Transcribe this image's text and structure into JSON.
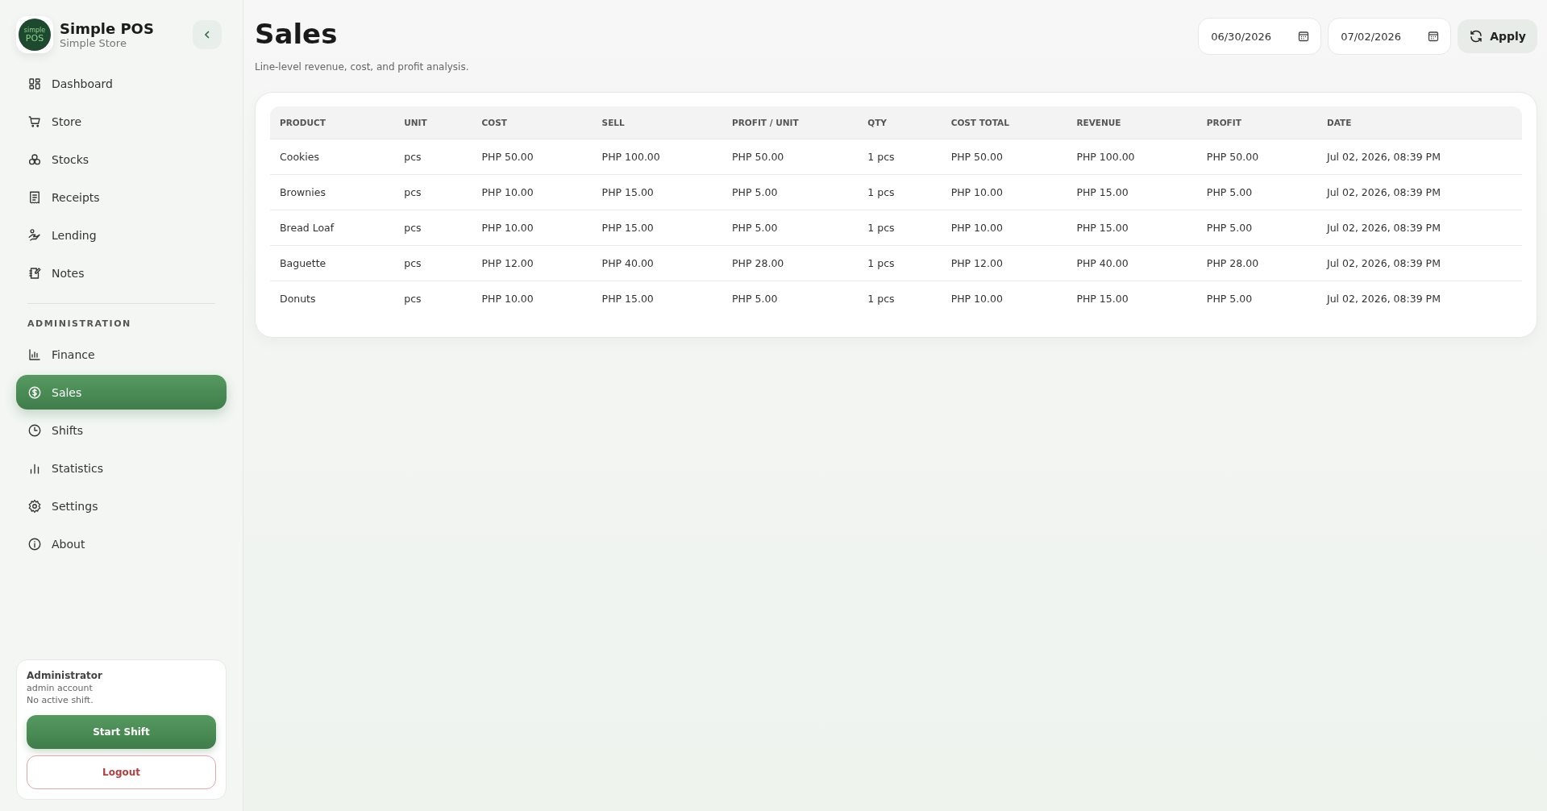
{
  "brand": {
    "title": "Simple POS",
    "subtitle": "Simple Store",
    "logo_top": "simple",
    "logo_bottom": "POS"
  },
  "nav": [
    {
      "label": "Dashboard",
      "kind": "dashboard",
      "selected": false
    },
    {
      "label": "Store",
      "kind": "cart",
      "selected": false
    },
    {
      "label": "Stocks",
      "kind": "boxes",
      "selected": false
    },
    {
      "label": "Receipts",
      "kind": "receipt",
      "selected": false
    },
    {
      "label": "Lending",
      "kind": "hand",
      "selected": false
    },
    {
      "label": "Notes",
      "kind": "notes",
      "selected": false
    }
  ],
  "admin_section": {
    "heading": "ADMINISTRATION",
    "items": [
      {
        "label": "Finance",
        "kind": "chart",
        "selected": false
      },
      {
        "label": "Sales",
        "kind": "dollar",
        "selected": true
      },
      {
        "label": "Shifts",
        "kind": "clock",
        "selected": false
      },
      {
        "label": "Statistics",
        "kind": "bars",
        "selected": false
      },
      {
        "label": "Settings",
        "kind": "gear",
        "selected": false
      },
      {
        "label": "About",
        "kind": "info",
        "selected": false
      }
    ]
  },
  "user_card": {
    "name": "Administrator",
    "role": "admin account",
    "shift_status": "No active shift.",
    "start_button": "Start Shift",
    "logout_button": "Logout"
  },
  "page": {
    "title": "Sales",
    "subtitle": "Line-level revenue, cost, and profit analysis.",
    "date_from": "06/30/2026",
    "date_to": "07/02/2026",
    "apply_button": "Apply"
  },
  "table": {
    "columns": [
      "PRODUCT",
      "UNIT",
      "COST",
      "SELL",
      "PROFIT / UNIT",
      "QTY",
      "COST TOTAL",
      "REVENUE",
      "PROFIT",
      "DATE"
    ],
    "rows": [
      [
        "Cookies",
        "pcs",
        "PHP 50.00",
        "PHP 100.00",
        "PHP 50.00",
        "1 pcs",
        "PHP 50.00",
        "PHP 100.00",
        "PHP 50.00",
        "Jul 02, 2026, 08:39 PM"
      ],
      [
        "Brownies",
        "pcs",
        "PHP 10.00",
        "PHP 15.00",
        "PHP 5.00",
        "1 pcs",
        "PHP 10.00",
        "PHP 15.00",
        "PHP 5.00",
        "Jul 02, 2026, 08:39 PM"
      ],
      [
        "Bread Loaf",
        "pcs",
        "PHP 10.00",
        "PHP 15.00",
        "PHP 5.00",
        "1 pcs",
        "PHP 10.00",
        "PHP 15.00",
        "PHP 5.00",
        "Jul 02, 2026, 08:39 PM"
      ],
      [
        "Baguette",
        "pcs",
        "PHP 12.00",
        "PHP 40.00",
        "PHP 28.00",
        "1 pcs",
        "PHP 12.00",
        "PHP 40.00",
        "PHP 28.00",
        "Jul 02, 2026, 08:39 PM"
      ],
      [
        "Donuts",
        "pcs",
        "PHP 10.00",
        "PHP 15.00",
        "PHP 5.00",
        "1 pcs",
        "PHP 10.00",
        "PHP 15.00",
        "PHP 5.00",
        "Jul 02, 2026, 08:39 PM"
      ]
    ]
  }
}
